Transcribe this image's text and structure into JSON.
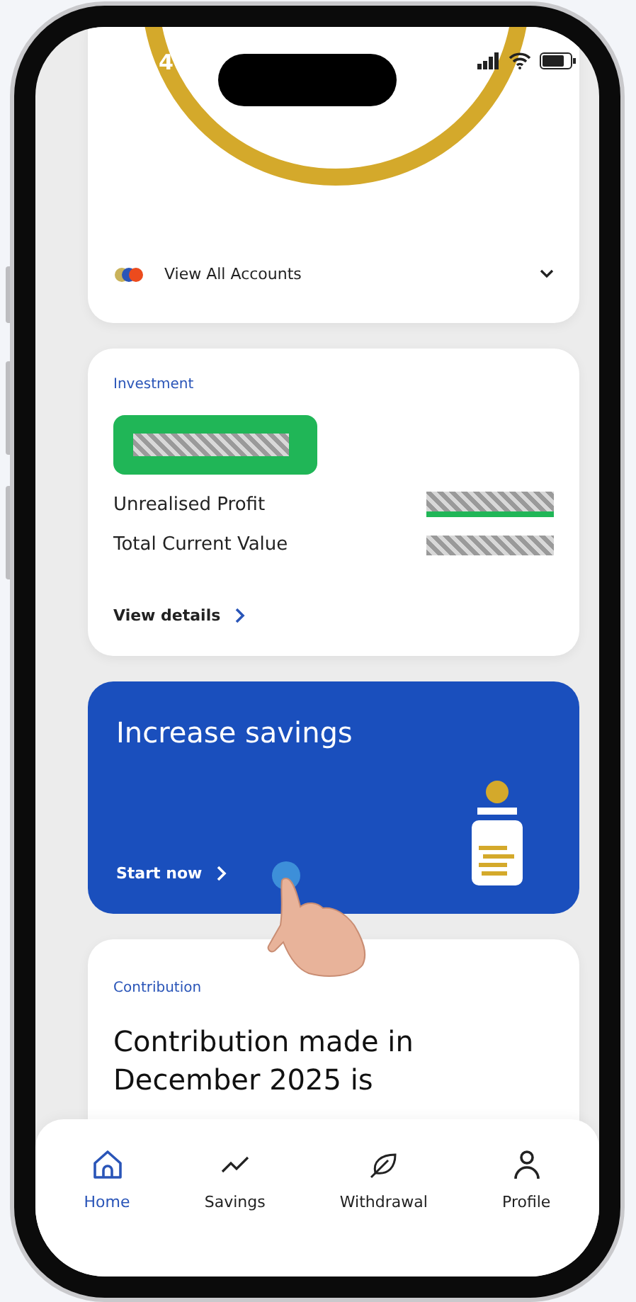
{
  "status_bar": {
    "time": "4"
  },
  "accounts_card": {
    "label": "View All Accounts"
  },
  "investment": {
    "title": "Investment",
    "rows": [
      {
        "label": "Unrealised Profit",
        "kind": "profit"
      },
      {
        "label": "Total Current Value",
        "kind": "plain"
      }
    ],
    "link": "View details"
  },
  "promo": {
    "title": "Increase savings",
    "action": "Start now"
  },
  "contribution": {
    "title": "Contribution",
    "message": "Contribution made in December 2025 is"
  },
  "nav": [
    {
      "label": "Home",
      "kind": "home",
      "selected": true
    },
    {
      "label": "Savings",
      "kind": "trend",
      "selected": false
    },
    {
      "label": "Withdrawal",
      "kind": "leaf",
      "selected": false
    },
    {
      "label": "Profile",
      "kind": "person",
      "selected": false
    }
  ]
}
